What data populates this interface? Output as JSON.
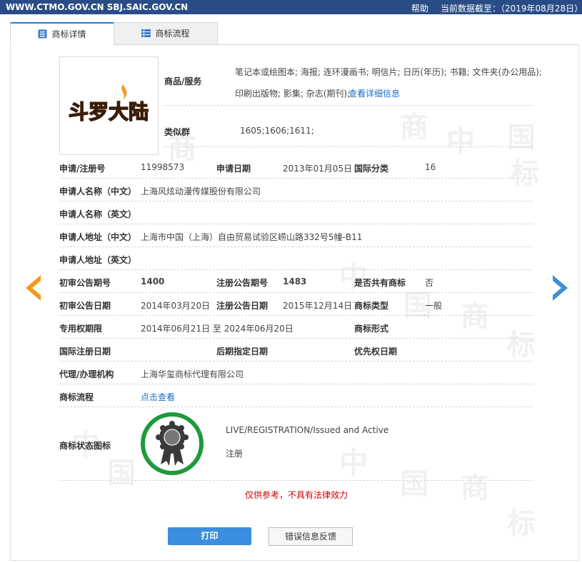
{
  "topbar": {
    "site": "WWW.CTMO.GOV.CN SBJ.SAIC.GOV.CN",
    "help": "帮助",
    "update": "当前数据截至：（2019年08月28日）"
  },
  "tabs": {
    "detail": "商标详情",
    "flow": "商标流程"
  },
  "watermark": [
    "中",
    "国",
    "商",
    "标"
  ],
  "trademark": {
    "logo_text": "斗罗大陆",
    "goods_label": "商品/服务",
    "goods_line1": "笔记本或绘图本; 海报; 连环漫画书; 明信片; 日历(年历); 书籍; 文件夹(办公用品);",
    "goods_line2": "印刷出版物; 影集; 杂志(期刊);",
    "goods_link": "查看详细信息",
    "similar_label": "类似群",
    "similar_value": "1605;1606;1611;"
  },
  "fields": {
    "reg_no_label": "申请/注册号",
    "reg_no": "11998573",
    "app_date_label": "申请日期",
    "app_date": "2013年01月05日",
    "intl_class_label": "国际分类",
    "intl_class": "16",
    "applicant_cn_label": "申请人名称（中文）",
    "applicant_cn": "上海风炫动漫传媒股份有限公司",
    "applicant_en_label": "申请人名称（英文）",
    "address_cn_label": "申请人地址（中文）",
    "address_cn": "上海市中国（上海）自由贸易试验区崂山路332号5幢-B11",
    "address_en_label": "申请人地址（英文）",
    "prelim_no_label": "初审公告期号",
    "prelim_no": "1400",
    "reg_pub_no_label": "注册公告期号",
    "reg_pub_no": "1483",
    "shared_label": "是否共有商标",
    "shared": "否",
    "prelim_date_label": "初审公告日期",
    "prelim_date": "2014年03月20日",
    "reg_pub_date_label": "注册公告日期",
    "reg_pub_date": "2015年12月14日",
    "tm_type_label": "商标类型",
    "tm_type": "一般",
    "exclusive_label": "专用权期限",
    "exclusive": "2014年06月21日 至 2024年06月20日",
    "tm_form_label": "商标形式",
    "intl_reg_date_label": "国际注册日期",
    "later_date_label": "后期指定日期",
    "priority_date_label": "优先权日期",
    "agent_label": "代理/办理机构",
    "agent": "上海华玺商标代理有限公司",
    "flow_label": "商标流程",
    "flow_link": "点击查看",
    "status_label": "商标状态图标",
    "status_en": "LIVE/REGISTRATION/Issued and Active",
    "status_cn": "注册"
  },
  "note": "仅供参考，不具有法律效力",
  "buttons": {
    "print": "打印",
    "report": "错误信息反馈"
  },
  "colors": {
    "topbar": "#2a4c86",
    "accent": "#3b8ee0",
    "arrow_prev": "#f39a1e",
    "arrow_next": "#3f8fd6",
    "status_ring": "#1e9a3c"
  }
}
